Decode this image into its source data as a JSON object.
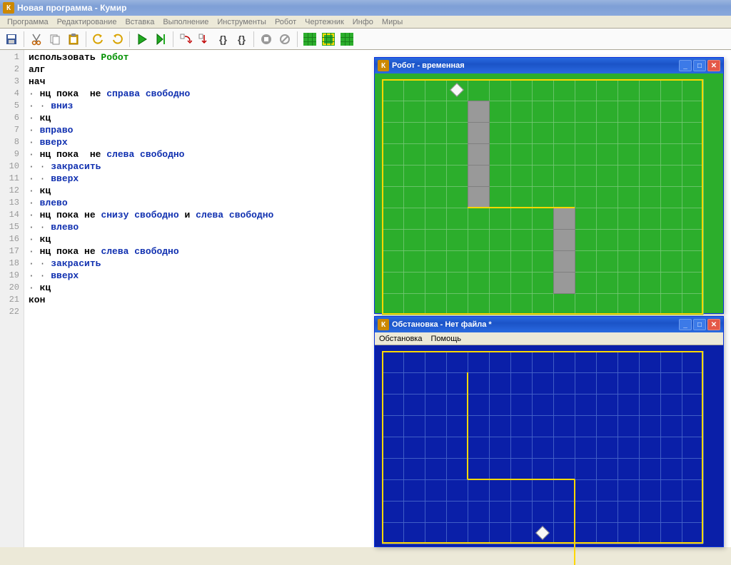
{
  "window": {
    "title": "Новая программа - Кумир"
  },
  "menu": {
    "items": [
      "Программа",
      "Редактирование",
      "Вставка",
      "Выполнение",
      "Инструменты",
      "Робот",
      "Чертежник",
      "Инфо",
      "Миры"
    ]
  },
  "code": {
    "lines": [
      {
        "n": 1,
        "tokens": [
          {
            "t": "использовать ",
            "c": "kw"
          },
          {
            "t": "Робот",
            "c": "name"
          }
        ]
      },
      {
        "n": 2,
        "tokens": [
          {
            "t": "алг",
            "c": "kw"
          }
        ]
      },
      {
        "n": 3,
        "tokens": [
          {
            "t": "нач",
            "c": "kw"
          }
        ]
      },
      {
        "n": 4,
        "tokens": [
          {
            "t": "· ",
            "c": "dot"
          },
          {
            "t": "нц пока",
            "c": "kw"
          },
          {
            "t": "  ",
            "c": ""
          },
          {
            "t": "не",
            "c": "kw"
          },
          {
            "t": " ",
            "c": ""
          },
          {
            "t": "справа свободно",
            "c": "cmd"
          }
        ]
      },
      {
        "n": 5,
        "tokens": [
          {
            "t": "· · ",
            "c": "dot"
          },
          {
            "t": "вниз",
            "c": "cmd"
          }
        ]
      },
      {
        "n": 6,
        "tokens": [
          {
            "t": "· ",
            "c": "dot"
          },
          {
            "t": "кц",
            "c": "kw"
          }
        ]
      },
      {
        "n": 7,
        "tokens": [
          {
            "t": "· ",
            "c": "dot"
          },
          {
            "t": "вправо",
            "c": "cmd"
          }
        ]
      },
      {
        "n": 8,
        "tokens": [
          {
            "t": "· ",
            "c": "dot"
          },
          {
            "t": "вверх",
            "c": "cmd"
          }
        ]
      },
      {
        "n": 9,
        "tokens": [
          {
            "t": "· ",
            "c": "dot"
          },
          {
            "t": "нц пока",
            "c": "kw"
          },
          {
            "t": "  ",
            "c": ""
          },
          {
            "t": "не",
            "c": "kw"
          },
          {
            "t": " ",
            "c": ""
          },
          {
            "t": "слева свободно",
            "c": "cmd"
          }
        ]
      },
      {
        "n": 10,
        "tokens": [
          {
            "t": "· · ",
            "c": "dot"
          },
          {
            "t": "закрасить",
            "c": "cmd"
          }
        ]
      },
      {
        "n": 11,
        "tokens": [
          {
            "t": "· · ",
            "c": "dot"
          },
          {
            "t": "вверх",
            "c": "cmd"
          }
        ]
      },
      {
        "n": 12,
        "tokens": [
          {
            "t": "· ",
            "c": "dot"
          },
          {
            "t": "кц",
            "c": "kw"
          }
        ]
      },
      {
        "n": 13,
        "tokens": [
          {
            "t": "· ",
            "c": "dot"
          },
          {
            "t": "влево",
            "c": "cmd"
          }
        ]
      },
      {
        "n": 14,
        "tokens": [
          {
            "t": "· ",
            "c": "dot"
          },
          {
            "t": "нц пока не",
            "c": "kw"
          },
          {
            "t": " ",
            "c": ""
          },
          {
            "t": "снизу свободно",
            "c": "cmd"
          },
          {
            "t": " ",
            "c": ""
          },
          {
            "t": "и",
            "c": "kw"
          },
          {
            "t": " ",
            "c": ""
          },
          {
            "t": "слева свободно",
            "c": "cmd"
          }
        ]
      },
      {
        "n": 15,
        "tokens": [
          {
            "t": "· · ",
            "c": "dot"
          },
          {
            "t": "влево",
            "c": "cmd"
          }
        ]
      },
      {
        "n": 16,
        "tokens": [
          {
            "t": "· ",
            "c": "dot"
          },
          {
            "t": "кц",
            "c": "kw"
          }
        ]
      },
      {
        "n": 17,
        "tokens": [
          {
            "t": "· ",
            "c": "dot"
          },
          {
            "t": "нц пока не",
            "c": "kw"
          },
          {
            "t": " ",
            "c": ""
          },
          {
            "t": "слева свободно",
            "c": "cmd"
          }
        ]
      },
      {
        "n": 18,
        "tokens": [
          {
            "t": "· · ",
            "c": "dot"
          },
          {
            "t": "закрасить",
            "c": "cmd"
          }
        ]
      },
      {
        "n": 19,
        "tokens": [
          {
            "t": "· · ",
            "c": "dot"
          },
          {
            "t": "вверх",
            "c": "cmd"
          }
        ]
      },
      {
        "n": 20,
        "tokens": [
          {
            "t": "· ",
            "c": "dot"
          },
          {
            "t": "кц",
            "c": "kw"
          }
        ]
      },
      {
        "n": 21,
        "tokens": [
          {
            "t": "кон",
            "c": "kw"
          }
        ]
      },
      {
        "n": 22,
        "tokens": [
          {
            "t": "",
            "c": ""
          }
        ]
      }
    ]
  },
  "robot_window": {
    "title": "Робот - временная",
    "grid": {
      "cols": 15,
      "rows": 11,
      "cell": 30
    },
    "robot": {
      "col": 3,
      "row": 0
    },
    "painted": [
      {
        "col": 4,
        "row": 1
      },
      {
        "col": 4,
        "row": 2
      },
      {
        "col": 4,
        "row": 3
      },
      {
        "col": 4,
        "row": 4
      },
      {
        "col": 4,
        "row": 5
      },
      {
        "col": 8,
        "row": 6
      },
      {
        "col": 8,
        "row": 7
      },
      {
        "col": 8,
        "row": 8
      },
      {
        "col": 8,
        "row": 9
      }
    ],
    "walls": [
      {
        "from": [
          4,
          6
        ],
        "to": [
          9,
          6
        ]
      }
    ]
  },
  "env_window": {
    "title": "Обстановка - Нет файла *",
    "menu": [
      "Обстановка",
      "Помощь"
    ],
    "grid": {
      "cols": 15,
      "rows": 11,
      "cell": 30
    },
    "robot": {
      "col": 7,
      "row": 9
    },
    "walls": [
      {
        "from": [
          4,
          6
        ],
        "to": [
          9,
          6
        ]
      },
      {
        "from": [
          4,
          1
        ],
        "to": [
          4,
          6
        ]
      },
      {
        "from": [
          9,
          6
        ],
        "to": [
          9,
          10
        ]
      }
    ]
  }
}
